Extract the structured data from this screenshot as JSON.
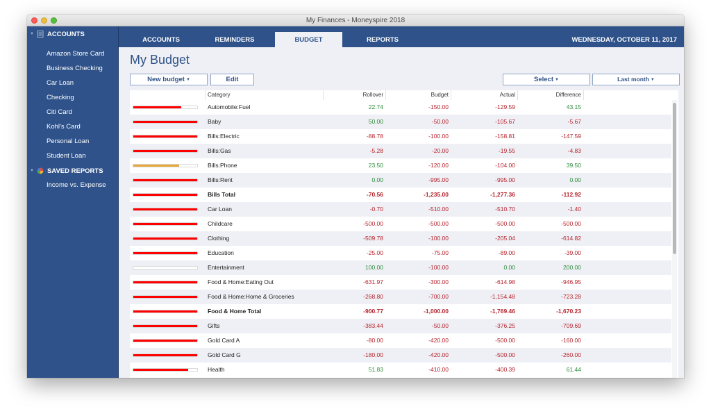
{
  "window": {
    "title": "My Finances - Moneyspire 2018"
  },
  "sidebar": {
    "accounts_header": "ACCOUNTS",
    "accounts": [
      "Amazon Store Card",
      "Business Checking",
      "Car Loan",
      "Checking",
      "Citi Card",
      "Kohl's Card",
      "Personal Loan",
      "Student Loan"
    ],
    "reports_header": "SAVED REPORTS",
    "reports": [
      "Income vs. Expense"
    ]
  },
  "tabs": [
    {
      "label": "ACCOUNTS",
      "active": false
    },
    {
      "label": "REMINDERS",
      "active": false
    },
    {
      "label": "BUDGET",
      "active": true
    },
    {
      "label": "REPORTS",
      "active": false
    }
  ],
  "date": "WEDNESDAY, OCTOBER 11, 2017",
  "page": {
    "title": "My Budget",
    "new_budget_label": "New budget",
    "edit_label": "Edit",
    "select_label": "Select",
    "period_label": "Last month"
  },
  "colors": {
    "positive": "#2e8b3a",
    "negative": "#b5242c",
    "bar_over": "#ff0000",
    "bar_warn": "#e8a93a",
    "accent": "#2e5289"
  },
  "table": {
    "headers": {
      "category": "Category",
      "rollover": "Rollover",
      "budget": "Budget",
      "actual": "Actual",
      "difference": "Difference"
    },
    "rows": [
      {
        "category": "Automobile:Fuel",
        "rollover": "22.74",
        "budget": "-150.00",
        "actual": "-129.59",
        "difference": "43.15",
        "progress": 0.75,
        "bar": "over",
        "total": false
      },
      {
        "category": "Baby",
        "rollover": "50.00",
        "budget": "-50.00",
        "actual": "-105.67",
        "difference": "-5.67",
        "progress": 1.0,
        "bar": "over",
        "total": false
      },
      {
        "category": "Bills:Electric",
        "rollover": "-88.78",
        "budget": "-100.00",
        "actual": "-158.81",
        "difference": "-147.59",
        "progress": 1.0,
        "bar": "over",
        "total": false
      },
      {
        "category": "Bills:Gas",
        "rollover": "-5.28",
        "budget": "-20.00",
        "actual": "-19.55",
        "difference": "-4.83",
        "progress": 1.0,
        "bar": "over",
        "total": false
      },
      {
        "category": "Bills:Phone",
        "rollover": "23.50",
        "budget": "-120.00",
        "actual": "-104.00",
        "difference": "39.50",
        "progress": 0.72,
        "bar": "warn",
        "total": false
      },
      {
        "category": "Bills:Rent",
        "rollover": "0.00",
        "budget": "-995.00",
        "actual": "-995.00",
        "difference": "0.00",
        "progress": 1.0,
        "bar": "over",
        "total": false
      },
      {
        "category": "Bills Total",
        "rollover": "-70.56",
        "budget": "-1,235.00",
        "actual": "-1,277.36",
        "difference": "-112.92",
        "progress": 1.0,
        "bar": "over",
        "total": true
      },
      {
        "category": "Car Loan",
        "rollover": "-0.70",
        "budget": "-510.00",
        "actual": "-510.70",
        "difference": "-1.40",
        "progress": 1.0,
        "bar": "over",
        "total": false
      },
      {
        "category": "Childcare",
        "rollover": "-500.00",
        "budget": "-500.00",
        "actual": "-500.00",
        "difference": "-500.00",
        "progress": 1.0,
        "bar": "over",
        "total": false
      },
      {
        "category": "Clothing",
        "rollover": "-509.78",
        "budget": "-100.00",
        "actual": "-205.04",
        "difference": "-614.82",
        "progress": 1.0,
        "bar": "over",
        "total": false
      },
      {
        "category": "Education",
        "rollover": "-25.00",
        "budget": "-75.00",
        "actual": "-89.00",
        "difference": "-39.00",
        "progress": 1.0,
        "bar": "over",
        "total": false
      },
      {
        "category": "Entertainment",
        "rollover": "100.00",
        "budget": "-100.00",
        "actual": "0.00",
        "difference": "200.00",
        "progress": 0.0,
        "bar": "over",
        "total": false
      },
      {
        "category": "Food & Home:Eating Out",
        "rollover": "-631.97",
        "budget": "-300.00",
        "actual": "-614.98",
        "difference": "-946.95",
        "progress": 1.0,
        "bar": "over",
        "total": false
      },
      {
        "category": "Food & Home:Home & Groceries",
        "rollover": "-268.80",
        "budget": "-700.00",
        "actual": "-1,154.48",
        "difference": "-723.28",
        "progress": 1.0,
        "bar": "over",
        "total": false
      },
      {
        "category": "Food & Home Total",
        "rollover": "-900.77",
        "budget": "-1,000.00",
        "actual": "-1,769.46",
        "difference": "-1,670.23",
        "progress": 1.0,
        "bar": "over",
        "total": true
      },
      {
        "category": "Gifts",
        "rollover": "-383.44",
        "budget": "-50.00",
        "actual": "-376.25",
        "difference": "-709.69",
        "progress": 1.0,
        "bar": "over",
        "total": false
      },
      {
        "category": "Gold Card A",
        "rollover": "-80.00",
        "budget": "-420.00",
        "actual": "-500.00",
        "difference": "-160.00",
        "progress": 1.0,
        "bar": "over",
        "total": false
      },
      {
        "category": "Gold Card G",
        "rollover": "-180.00",
        "budget": "-420.00",
        "actual": "-500.00",
        "difference": "-260.00",
        "progress": 1.0,
        "bar": "over",
        "total": false
      },
      {
        "category": "Health",
        "rollover": "51.83",
        "budget": "-410.00",
        "actual": "-400.39",
        "difference": "61.44",
        "progress": 0.86,
        "bar": "over",
        "total": false
      }
    ]
  }
}
